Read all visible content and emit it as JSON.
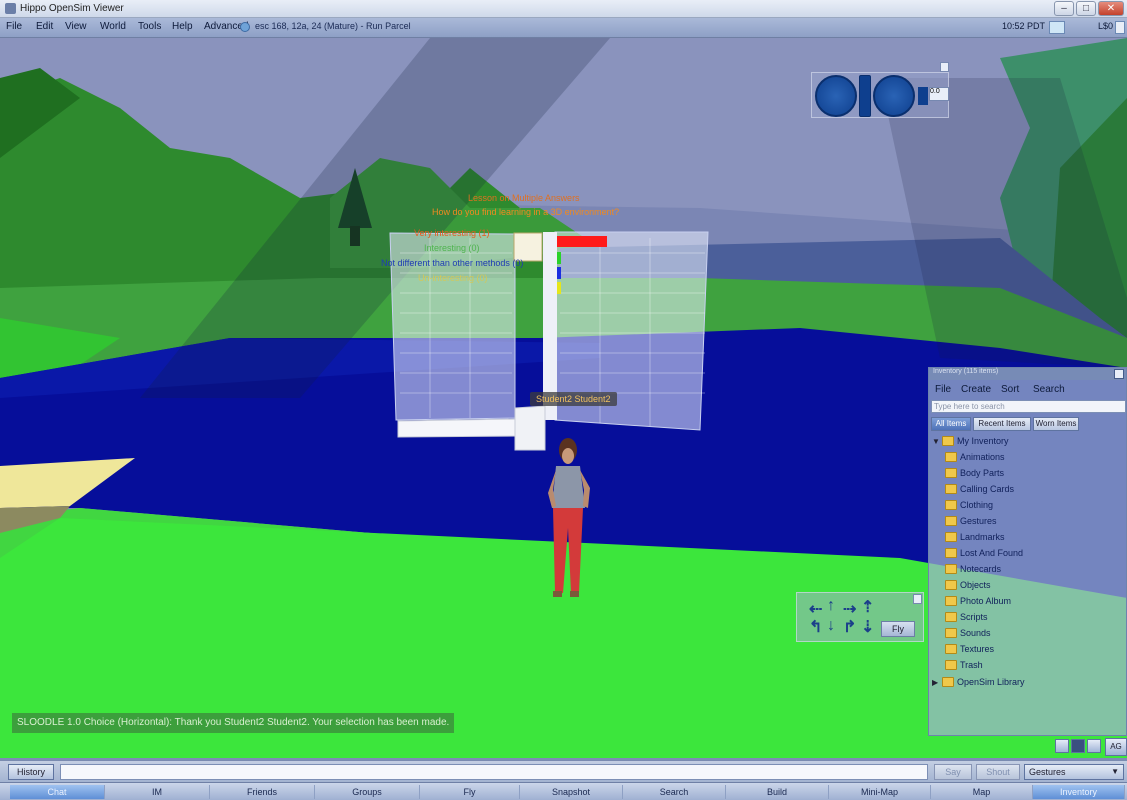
{
  "window": {
    "title": "Hippo OpenSim Viewer",
    "buttons": [
      "–",
      "□",
      "✕"
    ]
  },
  "menubar": {
    "items": [
      "File",
      "Edit",
      "View",
      "World",
      "Tools",
      "Help",
      "Advanced"
    ],
    "location": "esc 168, 12a, 24 (Mature) - Run Parcel",
    "clock": "10:52 PDT",
    "balance": "L$0"
  },
  "scene": {
    "poll": {
      "title": "Lesson on Multiple Answers",
      "question": "How do you find learning in a 3D environment?",
      "options": [
        {
          "label": "Very interesting (1)",
          "color": "#e65a1e"
        },
        {
          "label": "Interesting (0)",
          "color": "#50b450"
        },
        {
          "label": "Not different than other methods (0)",
          "color": "#1e3cb4"
        },
        {
          "label": "Un-interesting (0)",
          "color": "#d2c85a"
        }
      ]
    },
    "avatar_name": "Student2 Student2"
  },
  "camera_controls": {
    "zoom_value": "0.0"
  },
  "movement_controls": {
    "fly_label": "Fly"
  },
  "inventory": {
    "title": "Inventory (115 items)",
    "menu": [
      "File",
      "Create",
      "Sort",
      "Search"
    ],
    "search_placeholder": "Type here to search",
    "tabs": [
      "All Items",
      "Recent Items",
      "Worn Items"
    ],
    "root": "My Inventory",
    "folders": [
      "Animations",
      "Body Parts",
      "Calling Cards",
      "Clothing",
      "Gestures",
      "Landmarks",
      "Lost And Found",
      "Notecards",
      "Objects",
      "Photo Album",
      "Scripts",
      "Sounds",
      "Textures",
      "Trash"
    ],
    "library": "OpenSim Library",
    "ag_label": "AG"
  },
  "chat": {
    "message": "SLOODLE 1.0 Choice (Horizontal): Thank you Student2 Student2. Your selection has been made.",
    "history_label": "History",
    "say_label": "Say",
    "shout_label": "Shout",
    "gesture_label": "Gestures"
  },
  "toolbar": {
    "buttons": [
      "Chat",
      "IM",
      "Friends",
      "Groups",
      "Fly",
      "Snapshot",
      "Search",
      "Build",
      "Mini-Map",
      "Map",
      "Inventory"
    ],
    "active": [
      "Chat",
      "Inventory"
    ]
  }
}
